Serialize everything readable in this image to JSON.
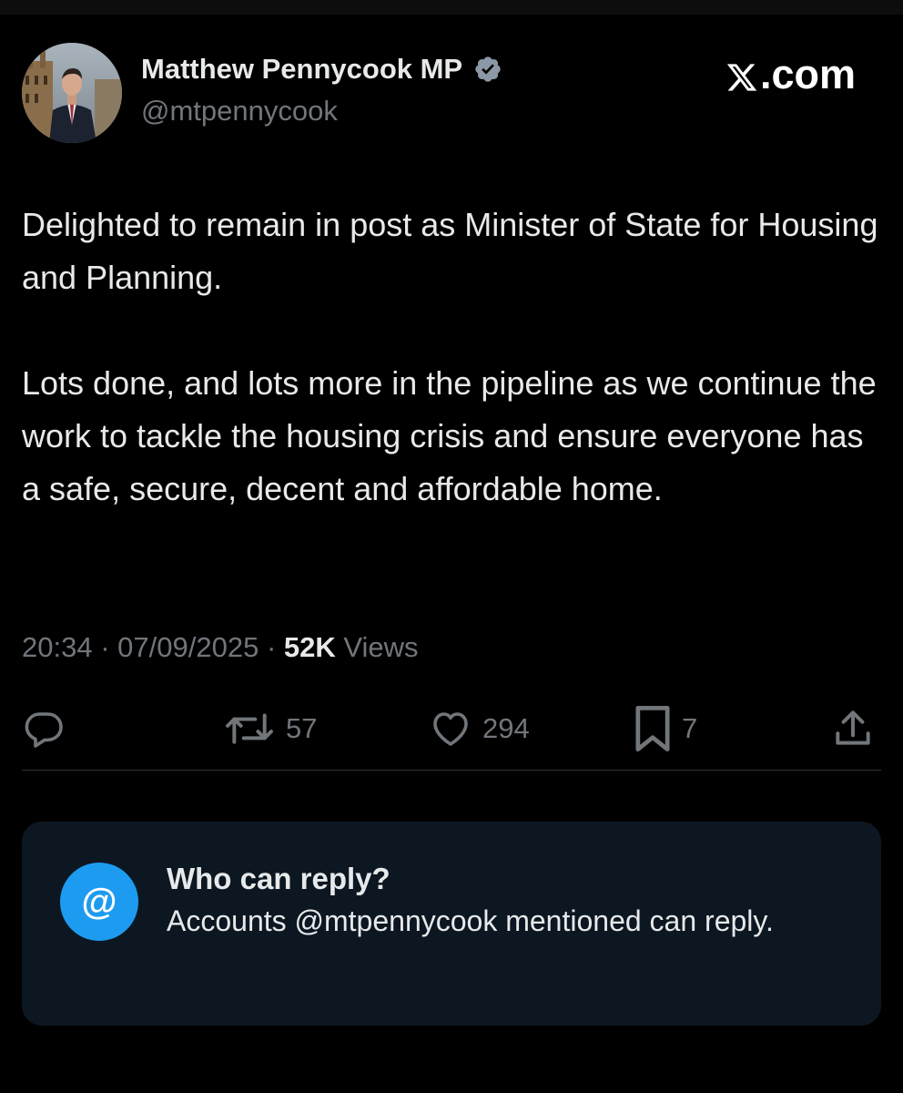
{
  "author": {
    "name": "Matthew Pennycook MP",
    "handle": "@mtpennycook",
    "verified_icon": "verified-badge-icon",
    "verified_color": "#8b98a5"
  },
  "brand": {
    "label": ".com",
    "logo_icon": "x-logo-icon"
  },
  "tweet": {
    "paragraphs": [
      "Delighted to remain in post as Minister of State for Housing and Planning.",
      "Lots done, and lots more in the pipeline as we continue the work to tackle the housing crisis and ensure everyone has a safe, secure, decent and affordable home."
    ],
    "time": "20:34",
    "date": "07/09/2025",
    "separator": "·",
    "views_count": "52K",
    "views_label": "Views"
  },
  "actions": {
    "reply": {
      "icon": "reply-icon",
      "count": ""
    },
    "repost": {
      "icon": "repost-icon",
      "count": "57"
    },
    "like": {
      "icon": "heart-icon",
      "count": "294"
    },
    "bookmark": {
      "icon": "bookmark-icon",
      "count": "7"
    },
    "share": {
      "icon": "share-icon",
      "count": ""
    }
  },
  "reply_settings": {
    "icon": "at-icon",
    "icon_glyph": "@",
    "title": "Who can reply?",
    "description": "Accounts @mtpennycook mentioned can reply."
  },
  "colors": {
    "background": "#000000",
    "text_primary": "#e7e9ea",
    "text_secondary": "#71767b",
    "accent": "#1d9bf0",
    "card_background": "#0c1722"
  }
}
